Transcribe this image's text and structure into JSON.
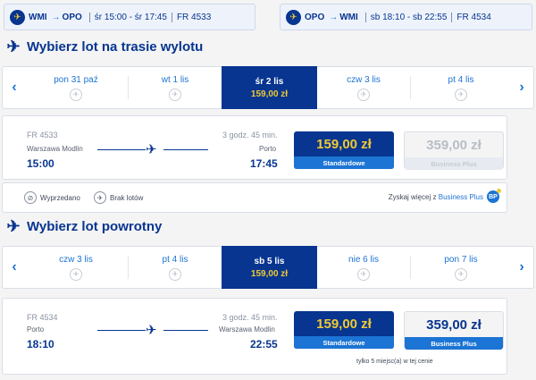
{
  "summary": {
    "outbound": {
      "from": "WMI",
      "to": "OPO",
      "schedule": "śr 15:00 - śr 17:45",
      "flight": "FR 4533"
    },
    "return": {
      "from": "OPO",
      "to": "WMI",
      "schedule": "sb 18:10 - sb 22:55",
      "flight": "FR 4534"
    }
  },
  "outbound": {
    "title": "Wybierz lot na trasie wylotu",
    "dates": [
      {
        "label": "pon 31 paź",
        "price": ""
      },
      {
        "label": "wt 1 lis",
        "price": ""
      },
      {
        "label": "śr 2 lis",
        "price": "159,00 zł"
      },
      {
        "label": "czw 3 lis",
        "price": ""
      },
      {
        "label": "pt 4 lis",
        "price": ""
      }
    ],
    "flight": {
      "number": "FR 4533",
      "from": "Warszawa Modlin",
      "dep": "15:00",
      "duration": "3 godz. 45 min.",
      "to": "Porto",
      "arr": "17:45",
      "standard_price": "159,00 zł",
      "standard_label": "Standardowe",
      "bp_price": "359,00 zł",
      "bp_label": "Business Plus"
    }
  },
  "legend": {
    "sold_out": "Wyprzedano",
    "no_flights": "Brak lotów",
    "bp_text": "Zyskaj więcej z",
    "bp_link": "Business Plus",
    "bp_badge": "BP"
  },
  "return": {
    "title": "Wybierz lot powrotny",
    "dates": [
      {
        "label": "czw 3 lis",
        "price": ""
      },
      {
        "label": "pt 4 lis",
        "price": ""
      },
      {
        "label": "sb 5 lis",
        "price": "159,00 zł"
      },
      {
        "label": "nie 6 lis",
        "price": ""
      },
      {
        "label": "pon 7 lis",
        "price": ""
      }
    ],
    "flight": {
      "number": "FR 4534",
      "from": "Porto",
      "dep": "18:10",
      "duration": "3 godz. 45 min.",
      "to": "Warszawa Modlin",
      "arr": "22:55",
      "standard_price": "159,00 zł",
      "standard_label": "Standardowe",
      "bp_price": "359,00 zł",
      "bp_label": "Business Plus",
      "seats_note": "tylko 5 miejsc(a) w tej cenie"
    }
  },
  "icons": {
    "plane": "airplane-icon",
    "chevron_left": "chevron-left-icon",
    "chevron_right": "chevron-right-icon",
    "no_flight": "no-flight-icon"
  },
  "colors": {
    "brand": "#073590",
    "accent": "#f1c933",
    "link": "#1c74d4"
  }
}
